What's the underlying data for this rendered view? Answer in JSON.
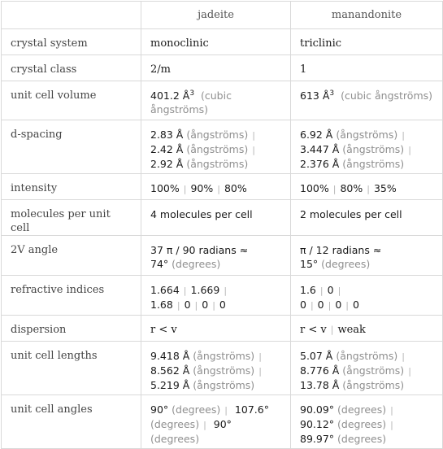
{
  "columns": [
    "",
    "jadeite",
    "manandonite"
  ],
  "rows": {
    "crystal_system": {
      "label": "crystal system",
      "jadeite": "monoclinic",
      "manandonite": "triclinic"
    },
    "crystal_class": {
      "label": "crystal class",
      "jadeite": "2/m",
      "manandonite": "1"
    },
    "unit_cell_volume": {
      "label": "unit cell volume",
      "jadeite": {
        "value": "401.2 Å",
        "exp": "3",
        "unit": "(cubic ångströms)"
      },
      "manandonite": {
        "value": "613 Å",
        "exp": "3",
        "unit": "(cubic ångströms)"
      }
    },
    "d_spacing": {
      "label": "d-spacing",
      "unit": "(ångströms)",
      "jadeite": [
        "2.83 Å",
        "2.42 Å",
        "2.92 Å"
      ],
      "manandonite": [
        "6.92 Å",
        "3.447 Å",
        "2.376 Å"
      ]
    },
    "intensity": {
      "label": "intensity",
      "jadeite": [
        "100%",
        "90%",
        "80%"
      ],
      "manandonite": [
        "100%",
        "80%",
        "35%"
      ]
    },
    "molecules": {
      "label": "molecules per unit cell",
      "jadeite": "4 molecules per cell",
      "manandonite": "2 molecules per cell"
    },
    "two_v_angle": {
      "label": "2V angle",
      "jadeite": {
        "radians": "37 π / 90 radians ≈",
        "degrees": "74°",
        "unit": "(degrees)"
      },
      "manandonite": {
        "radians": "π / 12 radians ≈",
        "degrees": "15°",
        "unit": "(degrees)"
      }
    },
    "refractive_indices": {
      "label": "refractive indices",
      "jadeite": [
        "1.664",
        "1.669",
        "1.68",
        "0",
        "0",
        "0"
      ],
      "manandonite": [
        "1.6",
        "0",
        "0",
        "0",
        "0",
        "0"
      ]
    },
    "dispersion": {
      "label": "dispersion",
      "jadeite": [
        "r < v"
      ],
      "manandonite": [
        "r < v",
        "weak"
      ]
    },
    "unit_cell_lengths": {
      "label": "unit cell lengths",
      "unit": "(ångströms)",
      "jadeite": [
        "9.418 Å",
        "8.562 Å",
        "5.219 Å"
      ],
      "manandonite": [
        "5.07 Å",
        "8.776 Å",
        "13.78 Å"
      ]
    },
    "unit_cell_angles": {
      "label": "unit cell angles",
      "unit": "(degrees)",
      "jadeite": [
        "90°",
        "107.6°",
        "90°"
      ],
      "manandonite": [
        "90.09°",
        "90.12°",
        "89.97°"
      ]
    }
  },
  "separator": "|"
}
